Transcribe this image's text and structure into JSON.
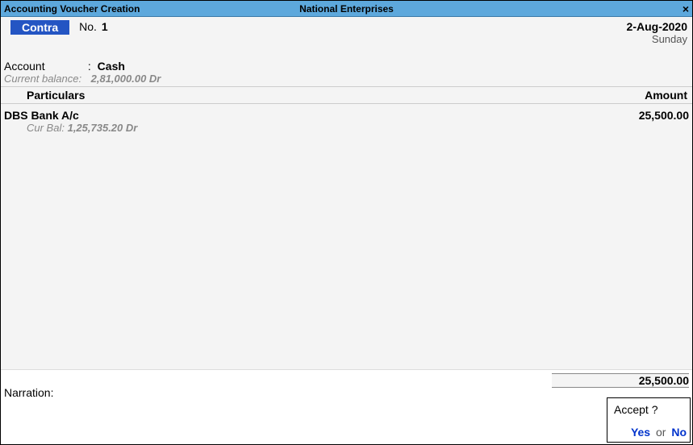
{
  "titlebar": {
    "left": "Accounting Voucher Creation",
    "center": "National Enterprises",
    "close": "×"
  },
  "voucher": {
    "type": "Contra",
    "no_label": "No.",
    "no_value": "1",
    "date": "2-Aug-2020",
    "day": "Sunday"
  },
  "account": {
    "label": "Account",
    "value": "Cash",
    "bal_label": "Current balance:",
    "bal_value": "2,81,000.00 Dr"
  },
  "headers": {
    "particulars": "Particulars",
    "amount": "Amount"
  },
  "entries": [
    {
      "name": "DBS Bank A/c",
      "amount": "25,500.00",
      "curbal_label": "Cur Bal:",
      "curbal_value": "1,25,735.20 Dr"
    }
  ],
  "total": "25,500.00",
  "narration": {
    "label": "Narration:",
    "value": ""
  },
  "dialog": {
    "title": "Accept ?",
    "yes": "Yes",
    "or": "or",
    "no": "No"
  }
}
